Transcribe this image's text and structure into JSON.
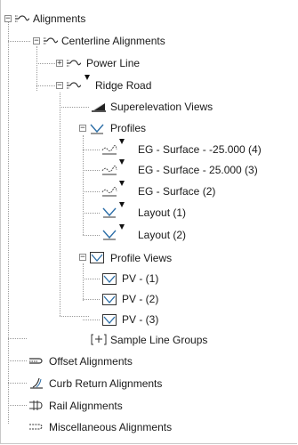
{
  "colors": {
    "line": "#9a9a9a",
    "icon_stroke": "#333333",
    "icon_accent": "#2d6fa8",
    "flag": "#111111"
  },
  "tree": {
    "root": {
      "label": "Alignments",
      "toggle": "−",
      "icon": "alignment-icon"
    },
    "centerline": {
      "label": "Centerline Alignments",
      "toggle": "−",
      "icon": "alignment-icon"
    },
    "power_line": {
      "label": "Power Line",
      "toggle": "+",
      "icon": "alignment-icon"
    },
    "ridge_road": {
      "label": "Ridge Road",
      "toggle": "−",
      "icon": "alignment-icon"
    },
    "superelevation": {
      "label": "Superelevation Views",
      "icon": "superelevation-view-icon"
    },
    "profiles": {
      "label": "Profiles",
      "toggle": "−",
      "icon": "profiles-icon"
    },
    "profile_items": [
      {
        "label": "EG - Surface - -25.000 (4)",
        "icon": "surface-profile-icon"
      },
      {
        "label": "EG - Surface - 25.000 (3)",
        "icon": "surface-profile-icon"
      },
      {
        "label": "EG - Surface (2)",
        "icon": "surface-profile-icon"
      },
      {
        "label": "Layout (1)",
        "icon": "layout-profile-icon"
      },
      {
        "label": "Layout (2)",
        "icon": "layout-profile-icon"
      }
    ],
    "profile_views": {
      "label": "Profile Views",
      "toggle": "−",
      "icon": "profile-view-icon"
    },
    "pv_items": [
      {
        "label": "PV - (1)",
        "icon": "profile-view-icon"
      },
      {
        "label": "PV - (2)",
        "icon": "profile-view-icon"
      },
      {
        "label": "PV - (3)",
        "icon": "profile-view-icon"
      }
    ],
    "sample_lines": {
      "label": "Sample Line Groups",
      "icon": "sample-line-group-icon"
    },
    "offset": {
      "label": "Offset Alignments",
      "icon": "offset-alignment-icon"
    },
    "curb_return": {
      "label": "Curb Return Alignments",
      "icon": "curb-return-icon"
    },
    "rail": {
      "label": "Rail Alignments",
      "icon": "rail-alignment-icon"
    },
    "misc": {
      "label": "Miscellaneous Alignments",
      "icon": "misc-alignment-icon"
    }
  }
}
